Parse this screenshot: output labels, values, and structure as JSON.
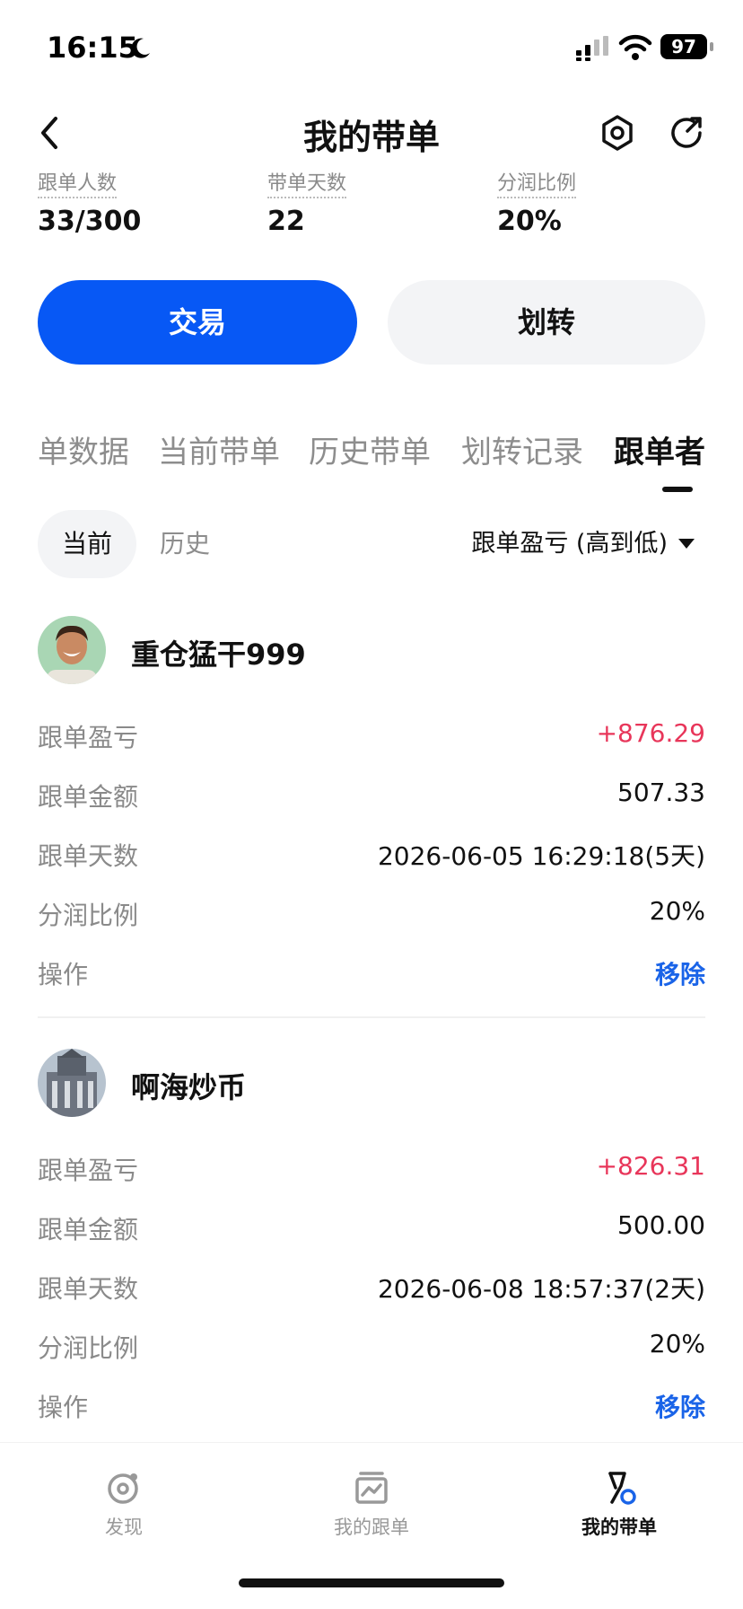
{
  "status": {
    "time": "16:15",
    "battery": "97"
  },
  "header": {
    "title": "我的带单"
  },
  "stats": [
    {
      "label": "跟单人数",
      "value": "33/300"
    },
    {
      "label": "带单天数",
      "value": "22"
    },
    {
      "label": "分润比例",
      "value": "20%"
    }
  ],
  "actions": {
    "trade": "交易",
    "transfer": "划转"
  },
  "tabs": [
    {
      "label": "单数据"
    },
    {
      "label": "当前带单"
    },
    {
      "label": "历史带单"
    },
    {
      "label": "划转记录"
    },
    {
      "label": "跟单者"
    }
  ],
  "filters": {
    "current": "当前",
    "history": "历史",
    "sort": "跟单盈亏 (高到低)"
  },
  "row_labels": {
    "pnl": "跟单盈亏",
    "amount": "跟单金额",
    "days": "跟单天数",
    "share": "分润比例",
    "op": "操作"
  },
  "followers": [
    {
      "name": "重仓猛干999",
      "pnl": "+876.29",
      "amount": "507.33",
      "days": "2026-06-05 16:29:18(5天)",
      "share": "20%",
      "action": "移除"
    },
    {
      "name": "啊海炒币",
      "pnl": "+826.31",
      "amount": "500.00",
      "days": "2026-06-08 18:57:37(2天)",
      "share": "20%",
      "action": "移除"
    }
  ],
  "bottom_nav": [
    {
      "label": "发现",
      "icon": "discover-icon"
    },
    {
      "label": "我的跟单",
      "icon": "chart-icon"
    },
    {
      "label": "我的带单",
      "icon": "flag-icon"
    }
  ],
  "colors": {
    "accent": "#0758f5",
    "profit": "#e8365a",
    "link": "#1a64e8"
  }
}
